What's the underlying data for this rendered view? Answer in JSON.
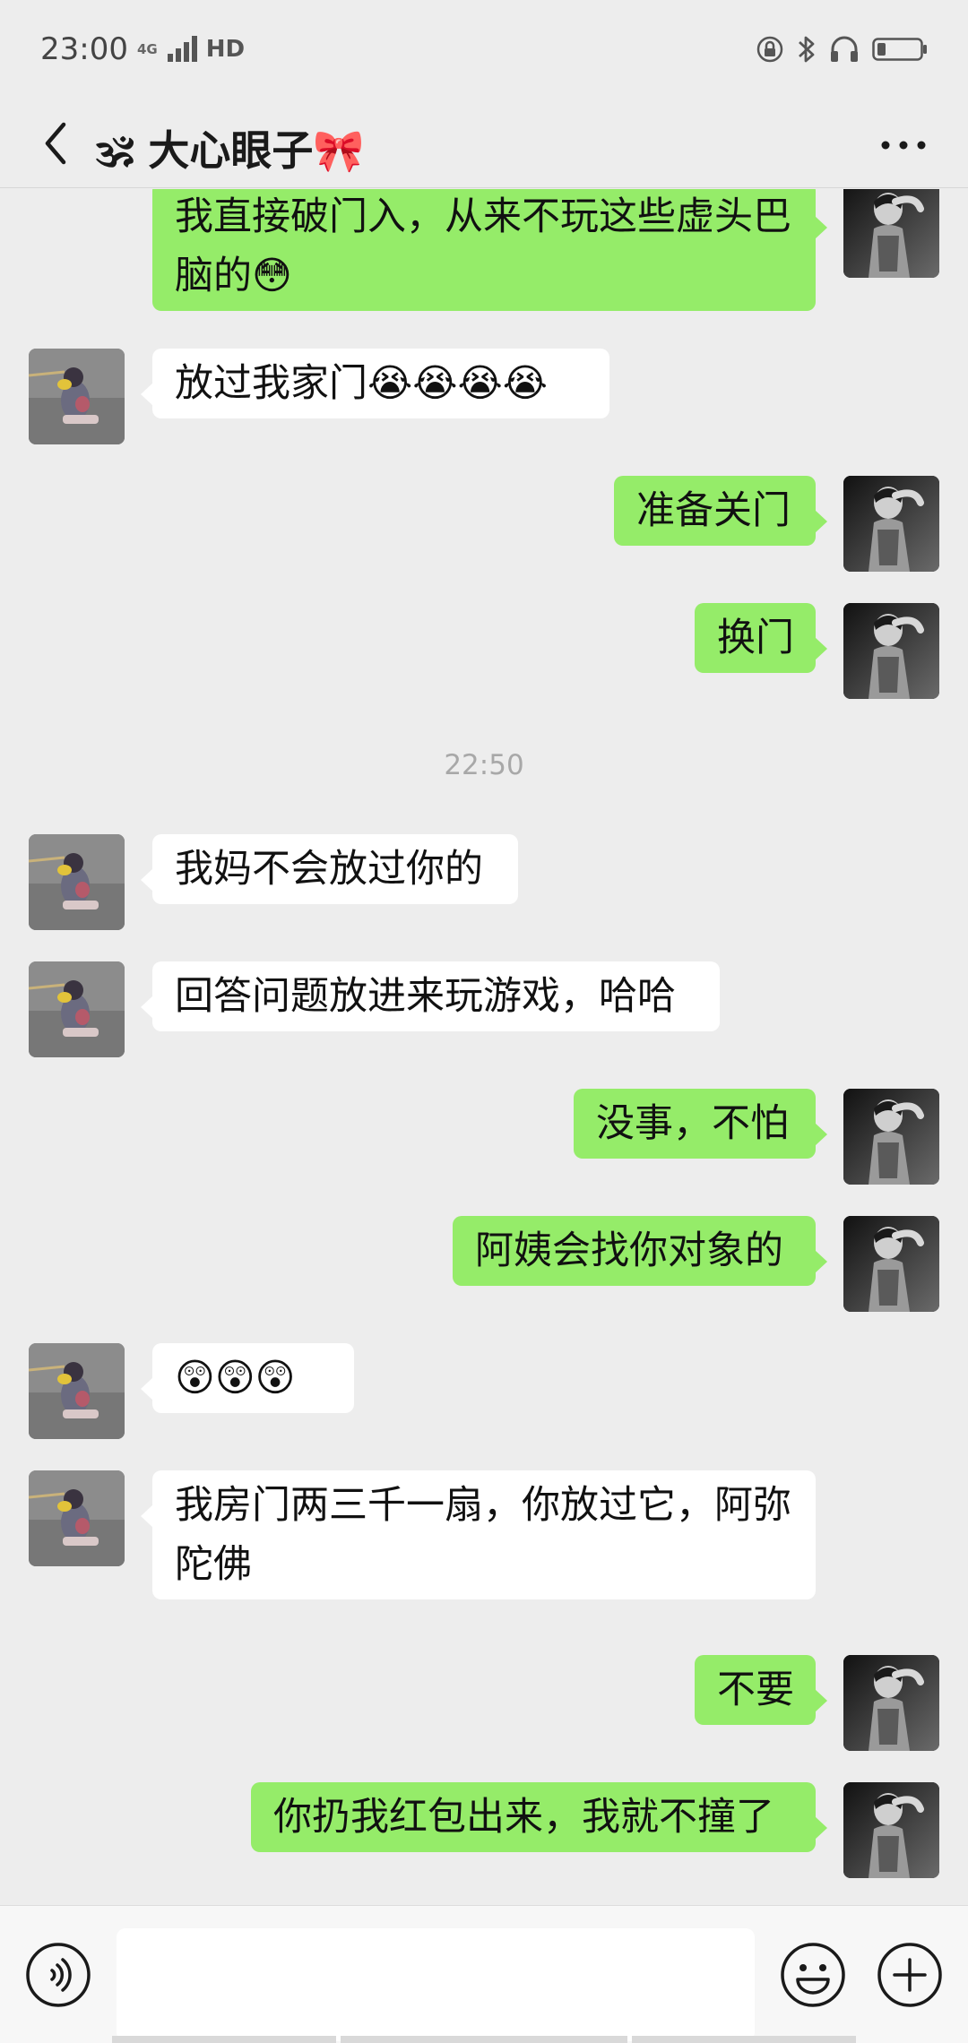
{
  "status_bar": {
    "time": "23:00",
    "network_type": "4G",
    "hd_label": "HD",
    "icons": [
      "lock-rotate-icon",
      "bluetooth-icon",
      "headphones-icon",
      "battery-icon"
    ]
  },
  "header": {
    "title": "🕉 大心眼子🎀",
    "back_icon": "chevron-left-icon",
    "more_icon": "more-dots-icon"
  },
  "messages": [
    {
      "side": "out",
      "text": "我直接破门入，从来不玩这些虚头巴脑的😳"
    },
    {
      "side": "in",
      "text": "放过我家门😭😭😭😭"
    },
    {
      "side": "out",
      "text": "准备关门"
    },
    {
      "side": "out",
      "text": "换门"
    },
    {
      "type": "time",
      "text": "22:50"
    },
    {
      "side": "in",
      "text": "我妈不会放过你的"
    },
    {
      "side": "in",
      "text": "回答问题放进来玩游戏，哈哈"
    },
    {
      "side": "out",
      "text": "没事，不怕"
    },
    {
      "side": "out",
      "text": "阿姨会找你对象的"
    },
    {
      "side": "in",
      "text": "😲😲😲"
    },
    {
      "side": "in",
      "text": "我房门两三千一扇，你放过它，阿弥陀佛"
    },
    {
      "side": "out",
      "text": "不要"
    },
    {
      "side": "out",
      "text": "你扔我红包出来，我就不撞了"
    }
  ],
  "input_bar": {
    "value": "",
    "voice_icon": "voice-icon",
    "emoji_icon": "emoji-icon",
    "plus_icon": "plus-icon"
  },
  "colors": {
    "background": "#ededed",
    "outgoing_bubble": "#95ec69",
    "incoming_bubble": "#ffffff",
    "timestamp": "#a8a8a8"
  }
}
